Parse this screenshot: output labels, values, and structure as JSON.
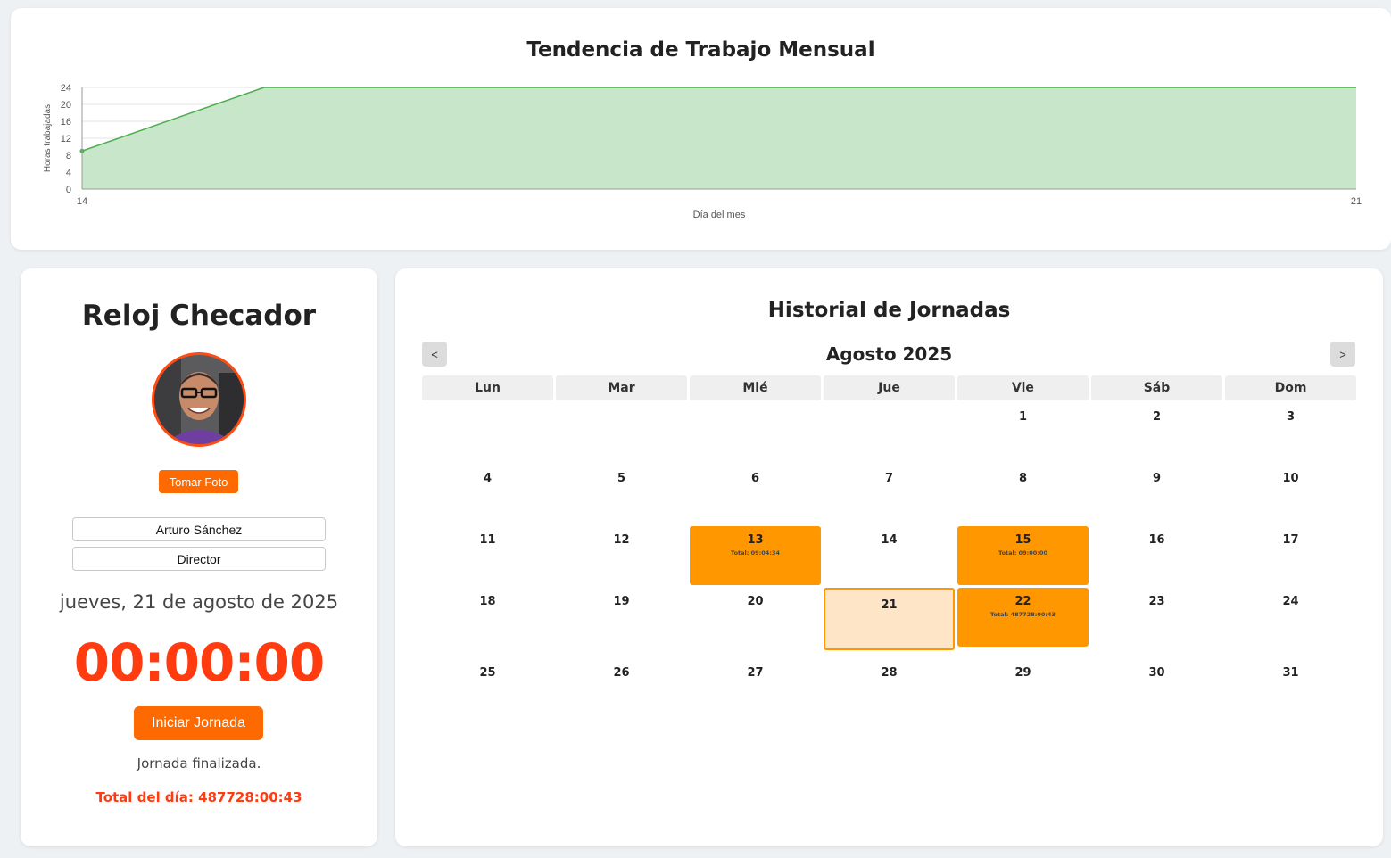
{
  "chart": {
    "title": "Tendencia de Trabajo Mensual",
    "chart_data": {
      "type": "area",
      "title": "Tendencia de Trabajo Mensual",
      "xlabel": "Día del mes",
      "ylabel": "Horas trabajadas",
      "x_tick_labels": [
        "14",
        "21"
      ],
      "y_tick_labels": [
        "0",
        "4",
        "8",
        "12",
        "16",
        "20",
        "24"
      ],
      "xlim": [
        14,
        21
      ],
      "ylim": [
        0,
        24
      ],
      "series": [
        {
          "x": [
            14,
            15,
            21
          ],
          "y": [
            9,
            24,
            24
          ]
        }
      ],
      "grid": true,
      "fill_color": "#c8e6c9",
      "line_color": "#4caf50"
    }
  },
  "clock": {
    "title": "Reloj Checador",
    "photo_button": "Tomar Foto",
    "name": "Arturo Sánchez",
    "role": "Director",
    "date": "jueves, 21 de agosto de 2025",
    "timer": "00:00:00",
    "start_button": "Iniciar Jornada",
    "status": "Jornada finalizada.",
    "total": "Total del día: 487728:00:43",
    "accent_color": "#ff6a00"
  },
  "calendar": {
    "title": "Historial de Jornadas",
    "prev": "<",
    "next": ">",
    "month": "Agosto 2025",
    "weekdays": [
      "Lun",
      "Mar",
      "Mié",
      "Jue",
      "Vie",
      "Sáb",
      "Dom"
    ],
    "first_weekday_index": 4,
    "days_in_month": 31,
    "today": 21,
    "worked_days": {
      "13": "Total: 09:04:34",
      "15": "Total: 09:00:00",
      "22": "Total: 487728:00:43"
    },
    "worked_color": "#ff9800"
  }
}
